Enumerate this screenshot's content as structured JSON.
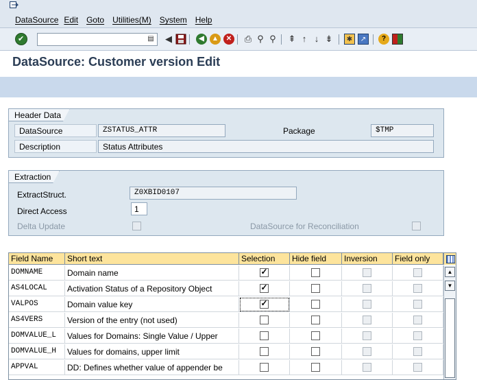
{
  "menubar": {
    "items": [
      "DataSource",
      "Edit",
      "Goto",
      "Utilities(M)",
      "System",
      "Help"
    ]
  },
  "toolbar": {
    "command_field_value": ""
  },
  "title": "DataSource: Customer version Edit",
  "header_data": {
    "tab": "Header Data",
    "datasource_label": "DataSource",
    "datasource_value": "ZSTATUS_ATTR",
    "package_label": "Package",
    "package_value": "$TMP",
    "description_label": "Description",
    "description_value": "Status Attributes"
  },
  "extraction": {
    "tab": "Extraction",
    "extract_struct_label": "ExtractStruct.",
    "extract_struct_value": "Z0XBID0107",
    "direct_access_label": "Direct Access",
    "direct_access_value": "1",
    "delta_update_label": "Delta Update",
    "reconciliation_label": "DataSource for Reconciliation"
  },
  "table": {
    "headers": [
      "Field Name",
      "Short text",
      "Selection",
      "Hide field",
      "Inversion",
      "Field only"
    ],
    "rows": [
      {
        "field": "DOMNAME",
        "text": "Domain name",
        "selection": true,
        "hide": false
      },
      {
        "field": "AS4LOCAL",
        "text": "Activation Status of a Repository Object",
        "selection": true,
        "hide": false
      },
      {
        "field": "VALPOS",
        "text": "Domain value key",
        "selection": true,
        "hide": false
      },
      {
        "field": "AS4VERS",
        "text": "Version of the entry (not used)",
        "selection": false,
        "hide": false
      },
      {
        "field": "DOMVALUE_L",
        "text": "Values for Domains: Single Value / Upper",
        "selection": false,
        "hide": false
      },
      {
        "field": "DOMVALUE_H",
        "text": "Values for domains, upper limit",
        "selection": false,
        "hide": false
      },
      {
        "field": "APPVAL",
        "text": "DD: Defines whether value of appender be",
        "selection": false,
        "hide": false
      }
    ]
  },
  "colors": {
    "menubar_bg": "#dfe7f0",
    "title_color": "#2b3d55",
    "group_bg": "#dde7ef",
    "table_header_bg": "#fde49c"
  }
}
